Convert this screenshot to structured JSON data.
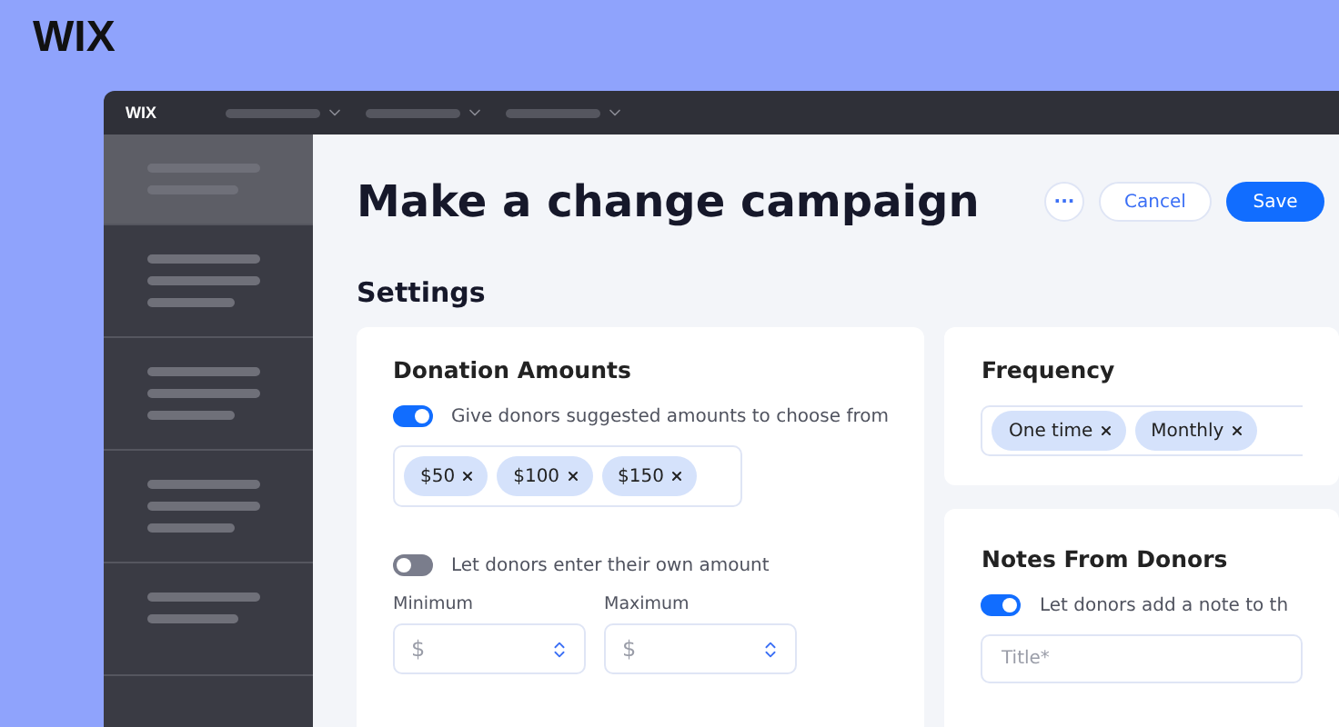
{
  "brand": {
    "logo": "WIX",
    "app_logo": "WIX"
  },
  "sidebar": {
    "items": [
      {
        "kind": "two-line",
        "selected": true
      },
      {
        "kind": "three-line",
        "selected": false
      },
      {
        "kind": "three-line",
        "selected": false
      },
      {
        "kind": "three-line",
        "selected": false
      },
      {
        "kind": "two-line",
        "selected": false
      }
    ]
  },
  "header": {
    "title": "Make a change campaign",
    "actions": [
      {
        "kind": "more",
        "label": "···"
      },
      {
        "kind": "secondary",
        "label": "Cancel"
      },
      {
        "kind": "primary",
        "label": "Save"
      }
    ]
  },
  "section_title": "Settings",
  "donation_amounts": {
    "title": "Donation Amounts",
    "suggested_toggle": {
      "label": "Give donors suggested amounts to choose from",
      "on": true
    },
    "amounts": [
      "$50",
      "$100",
      "$150"
    ],
    "own_amount_toggle": {
      "label": "Let donors enter their own amount",
      "on": false
    },
    "fields": [
      {
        "label": "Minimum",
        "prefix": "$"
      },
      {
        "label": "Maximum",
        "prefix": "$"
      }
    ]
  },
  "frequency": {
    "title": "Frequency",
    "options": [
      "One time",
      "Monthly"
    ]
  },
  "notes": {
    "title": "Notes From Donors",
    "toggle": {
      "label": "Let donors add a note to th",
      "on": true
    },
    "title_field": {
      "placeholder": "Title*"
    }
  }
}
